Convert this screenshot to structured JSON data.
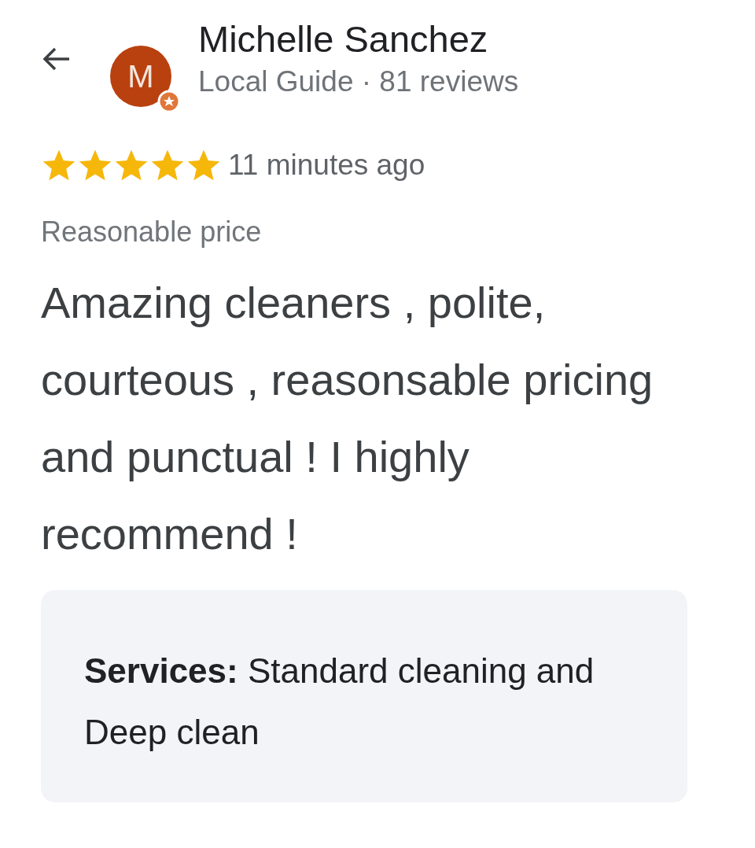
{
  "reviewer": {
    "avatar_letter": "M",
    "name": "Michelle Sanchez",
    "subtitle": "Local Guide · 81 reviews"
  },
  "review": {
    "stars": 5,
    "time": "11 minutes ago",
    "tag": "Reasonable price",
    "text": "Amazing cleaners , polite, courteous , reasonsable pricing and punctual ! I highly recommend !",
    "services": "**Services:** Standard cleaning and Deep clean"
  }
}
